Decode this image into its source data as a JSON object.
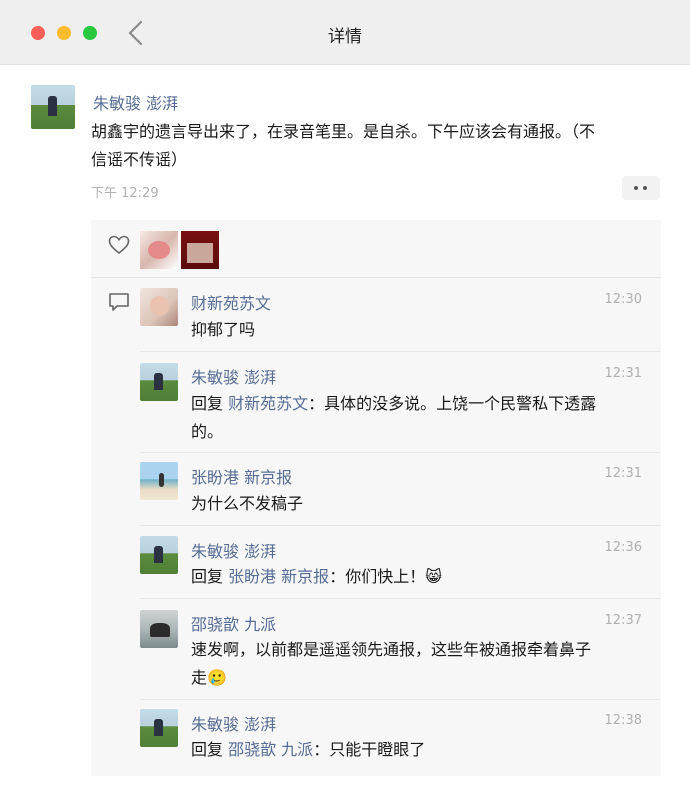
{
  "window": {
    "title": "详情"
  },
  "post": {
    "author": "朱敏骏 澎湃",
    "text_line1": "胡鑫宇的遗言导出来了，在录音笔里。是自杀。下午应该会有通报。（不",
    "text_line2": "信谣不传谣）",
    "time": "下午 12:29",
    "more_label": "••"
  },
  "comments": [
    {
      "author": "财新苑苏文",
      "time": "12:30",
      "text": "抑郁了吗"
    },
    {
      "author": "朱敏骏 澎湃",
      "time": "12:31",
      "reply_prefix": "回复 ",
      "reply_to": "财新苑苏文",
      "text": "：具体的没多说。上饶一个民警私下透露",
      "text2": "的。"
    },
    {
      "author": "张盼港 新京报",
      "time": "12:31",
      "text": "为什么不发稿子"
    },
    {
      "author": "朱敏骏 澎湃",
      "time": "12:36",
      "reply_prefix": "回复 ",
      "reply_to": "张盼港 新京报",
      "text": "：你们快上！",
      "emoji": "😸"
    },
    {
      "author": "邵骁歆  九派",
      "time": "12:37",
      "text": "速发啊，以前都是遥遥领先通报，这些年被通报牵着鼻子",
      "text2": "走",
      "emoji": "🥲"
    },
    {
      "author": "朱敏骏 澎湃",
      "time": "12:38",
      "reply_prefix": "回复 ",
      "reply_to": "邵骁歆  九派",
      "text": "：只能干瞪眼了"
    }
  ],
  "colors": {
    "name": "#566d94",
    "panel": "#f7f7f7",
    "close": "#fe5f57",
    "minimize": "#febc2e",
    "zoom": "#28c840"
  }
}
